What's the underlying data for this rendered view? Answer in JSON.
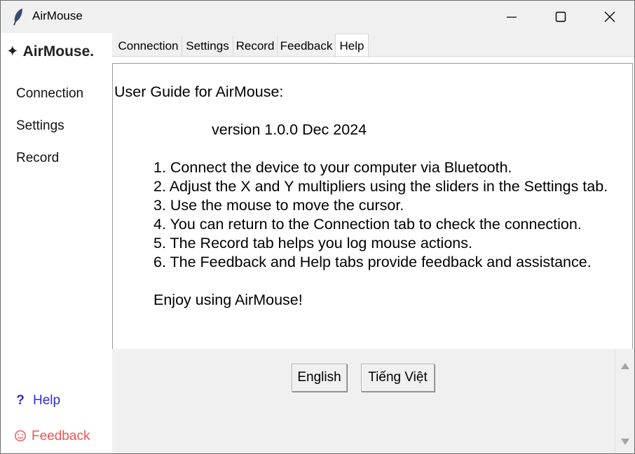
{
  "window": {
    "title": "AirMouse",
    "icons": {
      "app": "feather-icon",
      "minimize": "minimize-icon",
      "maximize": "maximize-icon",
      "close": "close-icon"
    }
  },
  "sidebar": {
    "brand": "AirMouse.",
    "brand_icon": "sparkle-icon",
    "items": [
      {
        "label": "Connection"
      },
      {
        "label": "Settings"
      },
      {
        "label": "Record"
      }
    ],
    "help": {
      "label": "Help",
      "icon": "question-icon",
      "color": "#2b2fd6"
    },
    "feedback": {
      "label": "Feedback",
      "icon": "smiley-icon",
      "color": "#f05454"
    }
  },
  "tabs": [
    {
      "label": "Connection"
    },
    {
      "label": "Settings"
    },
    {
      "label": "Record"
    },
    {
      "label": "Feedback"
    },
    {
      "label": "Help",
      "active": true
    }
  ],
  "guide": {
    "heading": "User Guide for AirMouse:",
    "version": "version 1.0.0 Dec 2024",
    "steps": [
      "1. Connect the device to your computer via Bluetooth.",
      "2. Adjust the X and Y multipliers using the sliders in the Settings tab.",
      "3. Use the mouse to move the cursor.",
      "4. You can return to the Connection tab to check the connection.",
      "5. The Record tab helps you log mouse actions.",
      "6. The Feedback and Help tabs provide feedback and assistance."
    ],
    "closing": "Enjoy using AirMouse!"
  },
  "language": {
    "english_label": "English",
    "vietnamese_label": "Tiếng Việt"
  }
}
